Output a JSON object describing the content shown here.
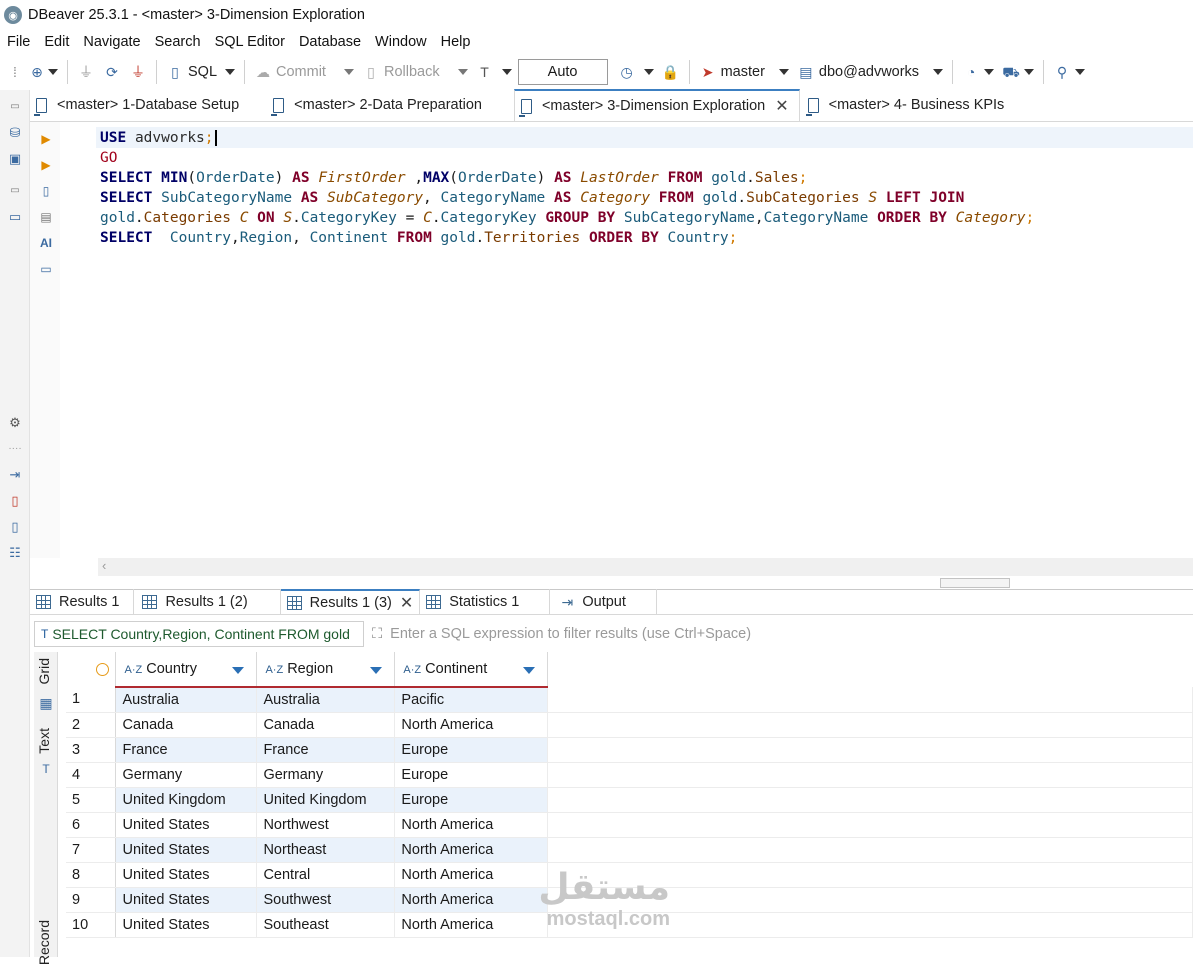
{
  "window": {
    "title": "DBeaver 25.3.1 - <master> 3-Dimension Exploration"
  },
  "menu": [
    "File",
    "Edit",
    "Navigate",
    "Search",
    "SQL Editor",
    "Database",
    "Window",
    "Help"
  ],
  "toolbar": {
    "sql_label": "SQL",
    "commit_label": "Commit",
    "rollback_label": "Rollback",
    "transaction_mode": "Auto",
    "datasource": "master",
    "schema": "dbo@advworks"
  },
  "editor_tabs": [
    {
      "label": "<master> 1-Database Setup"
    },
    {
      "label": "<master> 2-Data Preparation"
    },
    {
      "label": "<master> 3-Dimension Exploration",
      "active": true
    },
    {
      "label": "<master> 4- Business KPIs"
    }
  ],
  "editor": {
    "lines": [
      "USE advworks;",
      "GO",
      "SELECT MIN(OrderDate) AS FirstOrder ,MAX(OrderDate) AS LastOrder FROM gold.Sales;",
      "SELECT SubCategoryName AS SubCategory, CategoryName AS Category FROM gold.SubCategories S LEFT JOIN",
      "gold.Categories C ON S.CategoryKey = C.CategoryKey GROUP BY SubCategoryName,CategoryName ORDER BY Category;",
      "SELECT  Country,Region, Continent FROM gold.Territories ORDER BY Country;"
    ]
  },
  "results_tabs": [
    {
      "label": "Results 1"
    },
    {
      "label": "Results 1 (2)"
    },
    {
      "label": "Results 1 (3)",
      "active": true
    },
    {
      "label": "Statistics 1"
    },
    {
      "label": "Output"
    }
  ],
  "filter": {
    "query_text": "SELECT Country,Region, Continent FROM gold",
    "placeholder": "Enter a SQL expression to filter results (use Ctrl+Space)"
  },
  "side_tabs": {
    "grid": "Grid",
    "text": "Text",
    "record": "Record"
  },
  "grid": {
    "columns": [
      "Country",
      "Region",
      "Continent"
    ],
    "rows": [
      [
        "1",
        "Australia",
        "Australia",
        "Pacific"
      ],
      [
        "2",
        "Canada",
        "Canada",
        "North America"
      ],
      [
        "3",
        "France",
        "France",
        "Europe"
      ],
      [
        "4",
        "Germany",
        "Germany",
        "Europe"
      ],
      [
        "5",
        "United Kingdom",
        "United Kingdom",
        "Europe"
      ],
      [
        "6",
        "United States",
        "Northwest",
        "North America"
      ],
      [
        "7",
        "United States",
        "Northeast",
        "North America"
      ],
      [
        "8",
        "United States",
        "Central",
        "North America"
      ],
      [
        "9",
        "United States",
        "Southwest",
        "North America"
      ],
      [
        "10",
        "United States",
        "Southeast",
        "North America"
      ]
    ]
  },
  "watermark": {
    "arabic": "مستقل",
    "latin": "mostaql.com"
  }
}
